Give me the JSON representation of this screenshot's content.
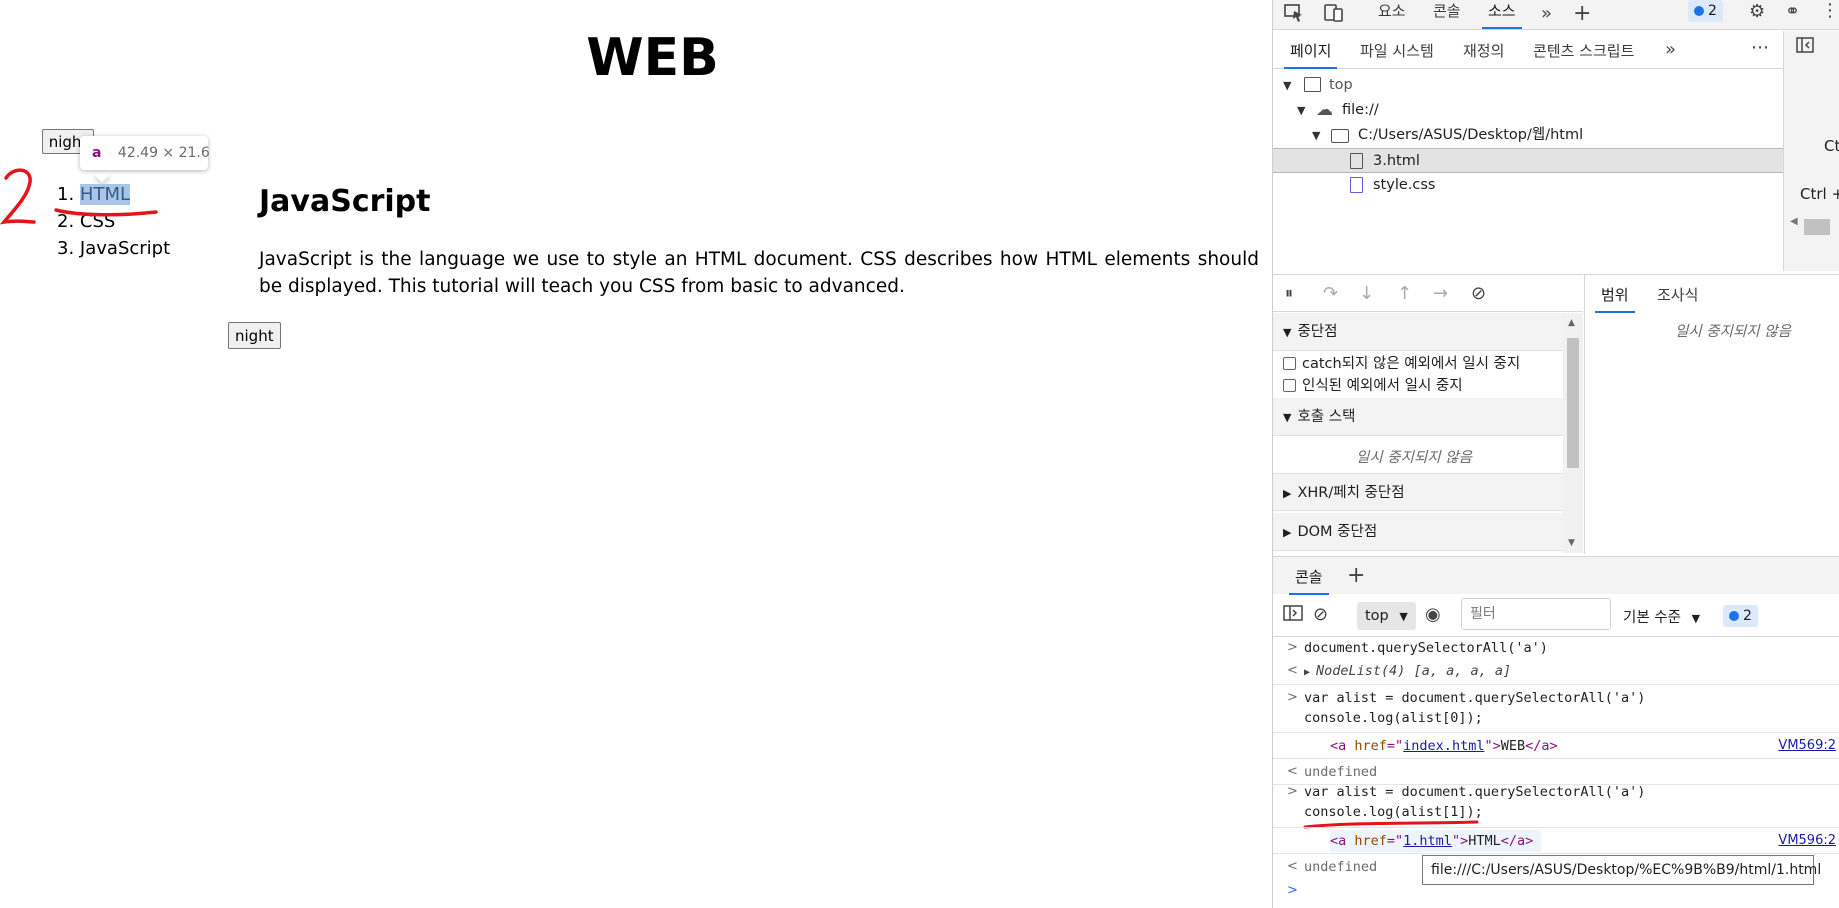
{
  "page": {
    "title": "WEB",
    "night_button_top": "night",
    "night_button_bottom": "night",
    "tooltip": {
      "tag": "a",
      "dims": "42.49 × 21.6"
    },
    "nav": [
      {
        "num": "1.",
        "label": "HTML"
      },
      {
        "num": "2.",
        "label": "CSS"
      },
      {
        "num": "3.",
        "label": "JavaScript"
      }
    ],
    "heading": "JavaScript",
    "body": "JavaScript is the language we use to style an HTML document. CSS describes how HTML elements should be displayed. This tutorial will teach you CSS from basic to advanced.",
    "annotation_mark": "2",
    "annotation_color": "#e3151a"
  },
  "devtools": {
    "main_tabs": [
      "요소",
      "콘솔",
      "소스"
    ],
    "issues_badge": "2",
    "sub_tabs": [
      "페이지",
      "파일 시스템",
      "재정의",
      "콘텐츠 스크립트"
    ],
    "right_strip_text": [
      "Ct",
      "Ctrl +"
    ],
    "tree": [
      {
        "label": "top"
      },
      {
        "label": "file://"
      },
      {
        "label": "C:/Users/ASUS/Desktop/웹/html"
      },
      {
        "label": "3.html"
      },
      {
        "label": "style.css"
      }
    ],
    "scope_tabs": [
      "범위",
      "조사식"
    ],
    "not_paused": "일시 중지되지 않음",
    "breakpoints": {
      "title": "중단점",
      "options": [
        "catch되지 않은 예외에서 일시 중지",
        "인식된 예외에서 일시 중지"
      ]
    },
    "call_stack": {
      "title": "호출 스택",
      "note": "일시 중지되지 않음"
    },
    "xhr_title": "XHR/페치 중단점",
    "dom_title": "DOM 중단점",
    "console_tab": "콘솔",
    "console_toolbar": {
      "context": "top",
      "filter_placeholder": "필터",
      "level": "기본 수준",
      "badge": "2"
    },
    "console_lines": {
      "l1": "document.querySelectorAll('a')",
      "l2": "NodeList(4) [a, a, a, a]",
      "l3a": "var alist = document.querySelectorAll('a')",
      "l3b": "console.log(alist[0]);",
      "l4_href": "index.html",
      "l4_text": "WEB",
      "l4_src": "VM569:2",
      "l5": "undefined",
      "l6a": "var alist = document.querySelectorAll('a')",
      "l6b": "console.log(alist[1]);",
      "l7_href": "1.html",
      "l7_text": "HTML",
      "l7_src": "VM596:2",
      "l8": "undefined"
    },
    "url_tooltip": "file:///C:/Users/ASUS/Desktop/%EC%9B%B9/html/1.html",
    "accent": "#1a73e8"
  }
}
